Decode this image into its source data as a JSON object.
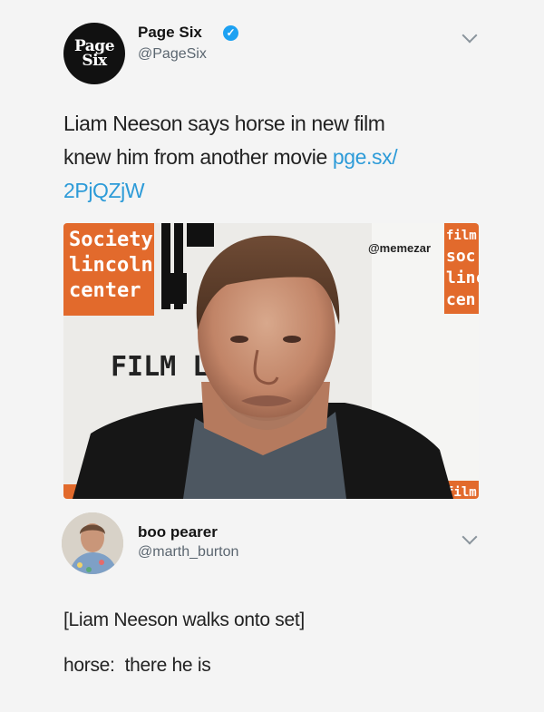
{
  "tweet": {
    "avatar_lines": [
      "Page",
      "Six"
    ],
    "author_name": "Page Six",
    "author_handle": "@PageSix",
    "text_line_1": "Liam Neeson says horse in new film",
    "text_line_2": "knew him from another movie ",
    "link_part_1": "pge.sx/",
    "link_part_2": "2PjQZjW",
    "media": {
      "watermark": "@memezar",
      "left_banner_line_1": "Society",
      "left_banner_line_2": "lincoln",
      "left_banner_line_3": "center",
      "backdrop_text": "FILM LI",
      "right_banner_line_1": "film",
      "right_banner_line_2": "soc",
      "right_banner_line_3": "linc",
      "right_banner_line_4": "cen",
      "right_banner_bottom": "film"
    }
  },
  "reply": {
    "author_name": "boo pearer",
    "author_handle": "@marth_burton",
    "line_1": "[Liam Neeson walks onto set]",
    "line_2": "horse:  there he is"
  },
  "colors": {
    "verified": "#1da1f2",
    "link": "#2d9bd8",
    "banner": "#e26a2c"
  }
}
